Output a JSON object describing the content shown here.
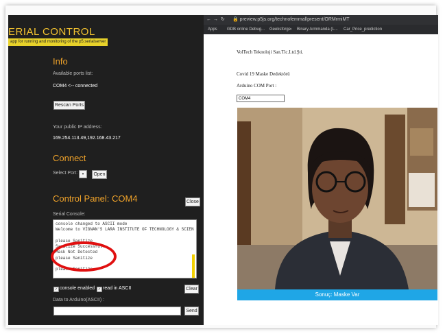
{
  "serial": {
    "title": "ERIAL CONTROL",
    "subtitle": "app for running and monitoring of the p5.serialserver",
    "info": {
      "heading": "Info",
      "ports_label": "Available ports list:",
      "port_status": "COM4 <-- connected",
      "rescan_label": "Rescan Ports",
      "ip_label": "Your public IP address:",
      "ip_value": "169.254.113.49,192.168.43.217"
    },
    "connect": {
      "heading": "Connect",
      "select_label": "Select Port:",
      "open_label": "Open"
    },
    "control": {
      "heading": "Control Panel: COM4",
      "close_label": "Close",
      "console_label": "Serial Console:",
      "console_lines": [
        "console changed to ASCII mode",
        "Welcome to VIGNAN'S LARA INSTITUTE OF TECHNOLOGY & SCIENCE",
        "",
        "please Sanitize",
        "Sanitize Successfull",
        "Mask Not Detected",
        "please Sanitize",
        "",
        "please Sanitize"
      ],
      "console_enabled_label": "console enabled",
      "read_ascii_label": "read in ASCII",
      "clear_label": "Clear",
      "send_data_label": "Data to Arduino(ASCII) :",
      "send_label": "Send"
    }
  },
  "browser": {
    "url": "preview.p5js.org/technofemmal/present/ORMrmiMT",
    "bookmarks": [
      "Apps",
      "GDB online Debug...",
      "Geeksforgeeks",
      "Binary Armmanda (L...",
      "Car_Price_prediction"
    ],
    "company": "VolTech Teknoloji San.Tic.Ltd.Şti.",
    "heading": "Covid 19 Maske Dedektörü",
    "com_label": "Arduino COM Port :",
    "com_value": "COM4",
    "result": "Sonuç: Maske Var"
  },
  "colors": {
    "accent": "#f0a32a",
    "result_bar": "#1fa6e6",
    "highlight_ring": "#e01010"
  }
}
